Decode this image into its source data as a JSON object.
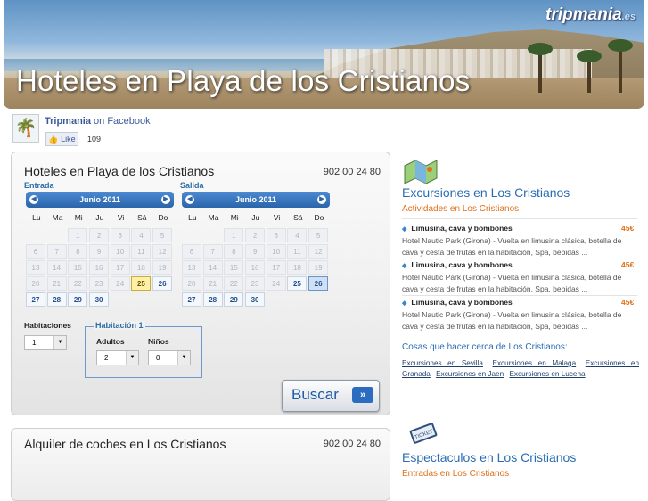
{
  "banner": {
    "title": "Hoteles en Playa de los Cristianos",
    "logo": "tripmania",
    "logo_suffix": ".es"
  },
  "facebook": {
    "name": "Tripmania",
    "suffix": "on Facebook",
    "like_label": "Like",
    "like_count": "109"
  },
  "booking": {
    "title": "Hoteles en Playa de los Cristianos",
    "phone": "902 00 24 80",
    "checkin_label": "Entrada",
    "checkout_label": "Salida",
    "calendar_checkin": {
      "month": "Junio 2011",
      "selected_day": "25"
    },
    "calendar_checkout": {
      "month": "Junio 2011",
      "selected_day": "26"
    },
    "weekdays": [
      "Lu",
      "Ma",
      "Mi",
      "Ju",
      "Vi",
      "Sá",
      "Do"
    ],
    "rooms_label": "Habitaciones",
    "rooms_value": "1",
    "room_group_label": "Habitación 1",
    "adults_label": "Adultos",
    "adults_value": "2",
    "children_label": "Niños",
    "children_value": "0",
    "search_button": "Buscar"
  },
  "cars": {
    "title": "Alquiler de coches en Los Cristianos",
    "phone": "902 00 24 80"
  },
  "excursions": {
    "icon": "map-icon",
    "title": "Excursiones en Los Cristianos",
    "subtitle": "Actividades en Los Cristianos",
    "items": [
      {
        "title": "Limusina, cava y bombones",
        "price": "45€",
        "desc": "Hotel Nautic Park (Girona) - Vuelta en limusina clásica, botella de cava y cesta de frutas en la habitación, Spa, bebidas ..."
      },
      {
        "title": "Limusina, cava y bombones",
        "price": "45€",
        "desc": "Hotel Nautic Park (Girona) - Vuelta en limusina clásica, botella de cava y cesta de frutas en la habitación, Spa, bebidas ..."
      },
      {
        "title": "Limusina, cava y bombones",
        "price": "45€",
        "desc": "Hotel Nautic Park (Girona) - Vuelta en limusina clásica, botella de cava y cesta de frutas en la habitación, Spa, bebidas ..."
      }
    ],
    "nearby_heading": "Cosas que hacer cerca de Los Cristianos:",
    "nearby_links": [
      "Excursiones en Sevilla",
      "Excursiones en Malaga",
      "Excursiones en Granada",
      "Excursiones en Jaen",
      "Excursiones en Lucena"
    ]
  },
  "shows": {
    "icon": "ticket-icon",
    "title": "Espectaculos en Los Cristianos",
    "subtitle": "Entradas en Los Cristianos"
  }
}
